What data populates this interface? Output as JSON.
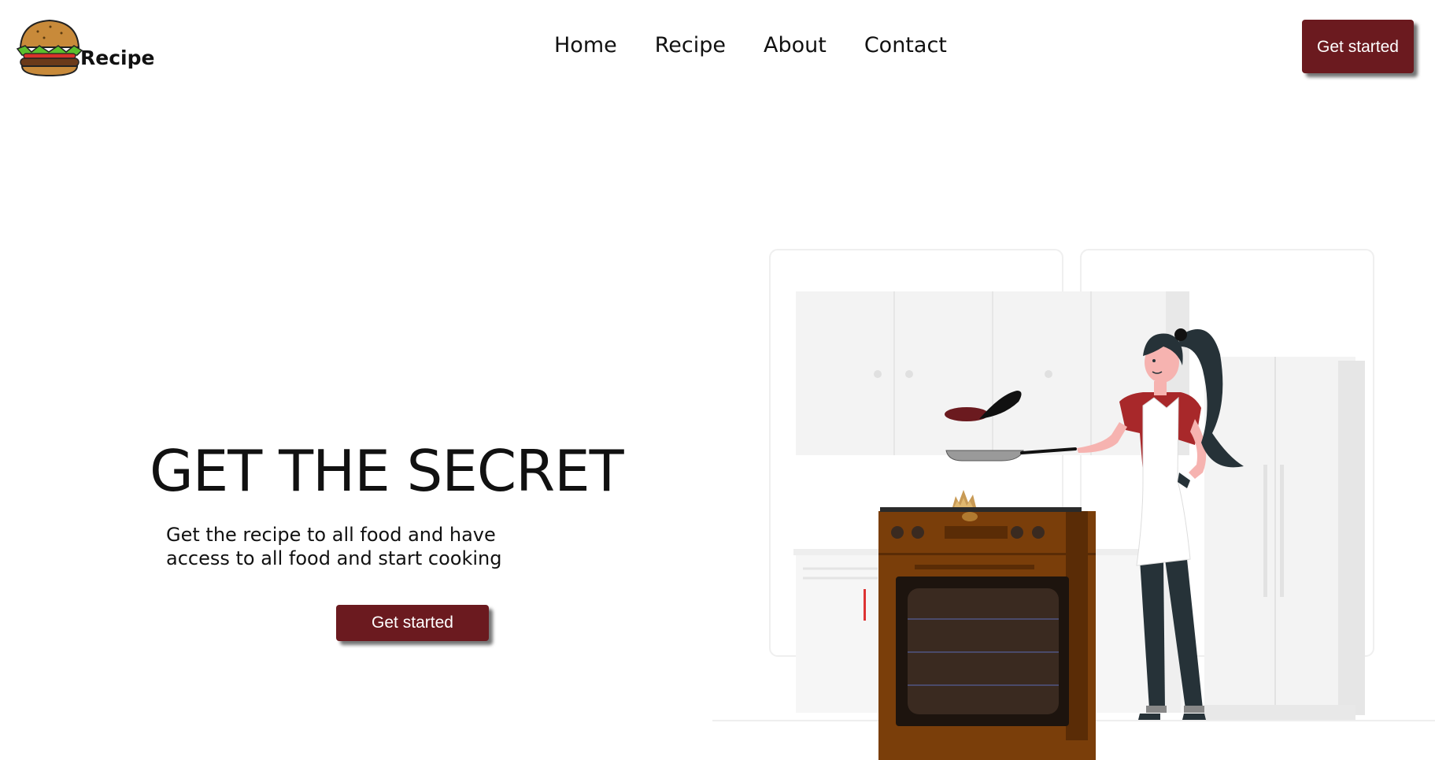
{
  "header": {
    "logo_text": "Recipe",
    "nav": [
      "Home",
      "Recipe",
      "About",
      "Contact"
    ],
    "cta_label": "Get started"
  },
  "hero": {
    "title": "GET THE SECRET",
    "subtitle": "Get the recipe to all food and have access to all food and start cooking",
    "cta_label": "Get started"
  },
  "colors": {
    "accent": "#6b1a1f",
    "oven": "#7a3e0a",
    "shirt": "#a8282a"
  },
  "icons": {
    "logo": "burger-icon"
  }
}
